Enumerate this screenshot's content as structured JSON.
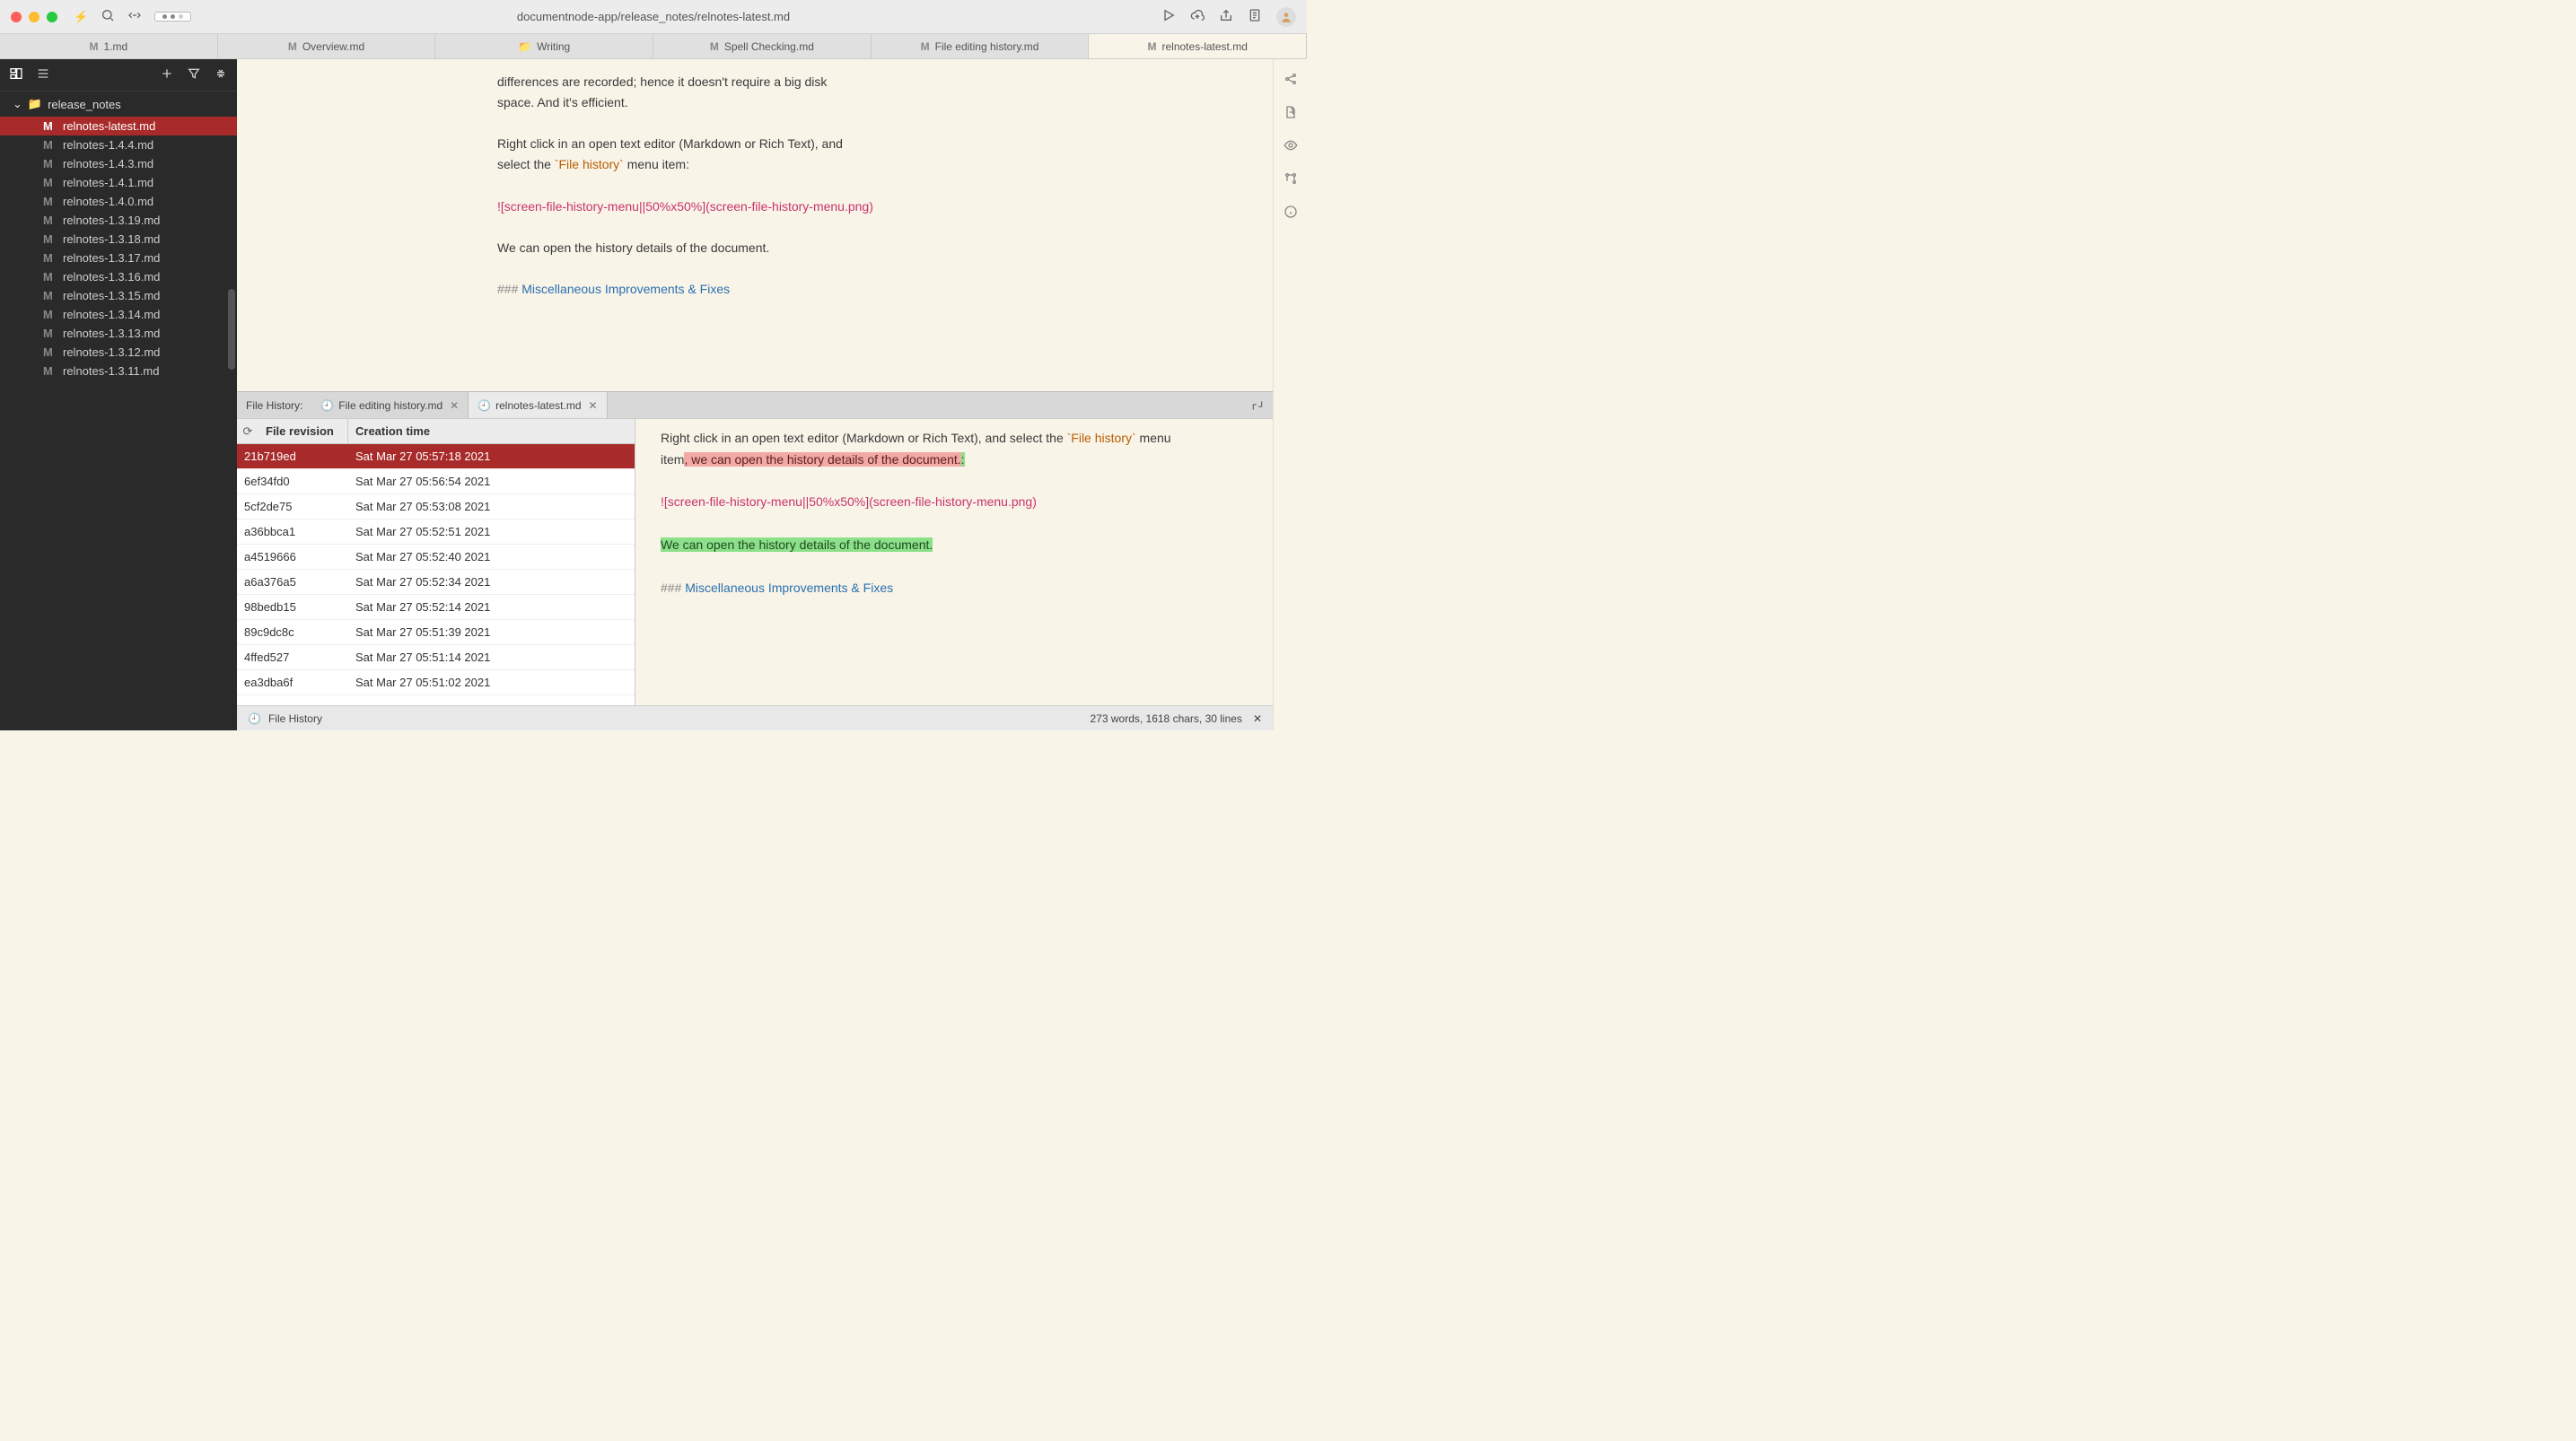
{
  "title_path": "documentnode-app/release_notes/relnotes-latest.md",
  "tabs": [
    {
      "badge": "M",
      "label": "1.md"
    },
    {
      "badge": "M",
      "label": "Overview.md"
    },
    {
      "folder": true,
      "label": "Writing"
    },
    {
      "badge": "M",
      "label": "Spell Checking.md"
    },
    {
      "badge": "M",
      "label": "File editing history.md"
    },
    {
      "badge": "M",
      "label": "relnotes-latest.md",
      "active": true
    }
  ],
  "sidebar": {
    "folder": "release_notes",
    "items": [
      "relnotes-latest.md",
      "relnotes-1.4.4.md",
      "relnotes-1.4.3.md",
      "relnotes-1.4.1.md",
      "relnotes-1.4.0.md",
      "relnotes-1.3.19.md",
      "relnotes-1.3.18.md",
      "relnotes-1.3.17.md",
      "relnotes-1.3.16.md",
      "relnotes-1.3.15.md",
      "relnotes-1.3.14.md",
      "relnotes-1.3.13.md",
      "relnotes-1.3.12.md",
      "relnotes-1.3.11.md"
    ]
  },
  "editor_top": {
    "l1": "differences are recorded; hence it doesn't require a big disk",
    "l2": "space. And it's efficient.",
    "l3": "Right click in an open text editor (Markdown or Rich Text), and",
    "l4a": "select the ",
    "l4code": "`File history`",
    "l4b": " menu item:",
    "l5": "![screen-file-history-menu||50%x50%](screen-file-history-menu.png)",
    "l6": "We can open the history details of the document.",
    "l7hash": "###",
    "l7": " Miscellaneous Improvements & Fixes"
  },
  "panel": {
    "label": "File History:",
    "tab1": "File editing history.md",
    "tab2": "relnotes-latest.md",
    "th1": "File revision",
    "th2": "Creation time",
    "rows": [
      {
        "rev": "21b719ed",
        "time": "Sat Mar 27 05:57:18 2021",
        "sel": true
      },
      {
        "rev": "6ef34fd0",
        "time": "Sat Mar 27 05:56:54 2021"
      },
      {
        "rev": "5cf2de75",
        "time": "Sat Mar 27 05:53:08 2021"
      },
      {
        "rev": "a36bbca1",
        "time": "Sat Mar 27 05:52:51 2021"
      },
      {
        "rev": "a4519666",
        "time": "Sat Mar 27 05:52:40 2021"
      },
      {
        "rev": "a6a376a5",
        "time": "Sat Mar 27 05:52:34 2021"
      },
      {
        "rev": "98bedb15",
        "time": "Sat Mar 27 05:52:14 2021"
      },
      {
        "rev": "89c9dc8c",
        "time": "Sat Mar 27 05:51:39 2021"
      },
      {
        "rev": "4ffed527",
        "time": "Sat Mar 27 05:51:14 2021"
      },
      {
        "rev": "ea3dba6f",
        "time": "Sat Mar 27 05:51:02 2021"
      }
    ]
  },
  "diff": {
    "l1a": "Right click in an open text editor (Markdown or Rich Text), and select the ",
    "l1code": "`File history`",
    "l1b": " menu ",
    "l2a": "item",
    "l2del": ", we can open the history details of the document.",
    "l2colon": ":",
    "l3": "![screen-file-history-menu||50%x50%](screen-file-history-menu.png)",
    "l4add": "We can open the history details of the document.",
    "l5hash": "###",
    "l5": " Miscellaneous Improvements & Fixes"
  },
  "status": {
    "file_history": "File History",
    "stats": "273 words, 1618 chars, 30 lines"
  }
}
